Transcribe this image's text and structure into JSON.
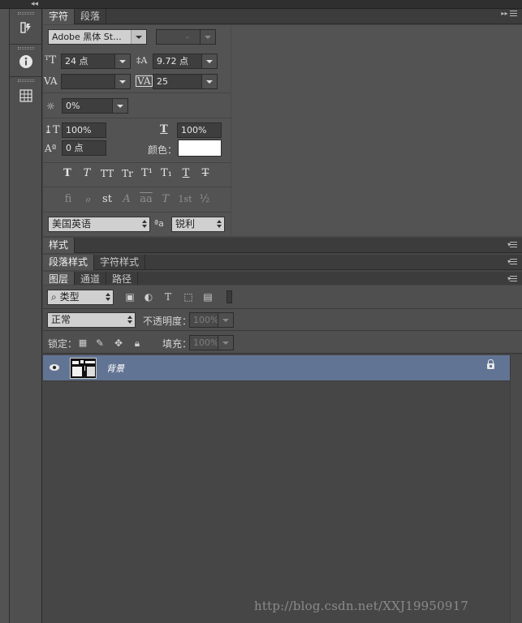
{
  "character_panel": {
    "tabs": [
      {
        "label": "字符"
      },
      {
        "label": "段落"
      }
    ],
    "font_family": "Adobe 黑体 St...",
    "font_style": "-",
    "font_size": "24 点",
    "leading": "9.72 点",
    "kerning": "",
    "tracking": "25",
    "tsume": "0%",
    "vertical_scale": "100%",
    "horizontal_scale": "100%",
    "baseline_shift": "0 点",
    "color_label": "颜色：",
    "color_value": "#ffffff",
    "style_buttons": [
      "T",
      "T",
      "TT",
      "Tr",
      "T¹",
      "T₁",
      "T",
      "T"
    ],
    "opentype_buttons": [
      "ﬁ",
      "ℴ",
      "st",
      "A",
      "aa",
      "T",
      "1st",
      "½"
    ],
    "language": "美国英语",
    "aa_label": "ªa",
    "antialias": "锐利"
  },
  "styles_panel": {
    "tabs": [
      {
        "label": "样式"
      }
    ]
  },
  "para_styles_panel": {
    "tabs": [
      {
        "label": "段落样式"
      },
      {
        "label": "字符样式"
      }
    ]
  },
  "layers_panel": {
    "tabs": [
      {
        "label": "图层"
      },
      {
        "label": "通道"
      },
      {
        "label": "路径"
      }
    ],
    "filter_kind": "类型",
    "blend_mode": "正常",
    "opacity_label": "不透明度：",
    "opacity_value": "100%",
    "lock_label": "锁定：",
    "fill_label": "填充：",
    "fill_value": "100%",
    "layers": [
      {
        "name": "背景",
        "visible": true,
        "locked": true
      }
    ]
  },
  "watermark": "http://blog.csdn.net/XXJ19950917"
}
